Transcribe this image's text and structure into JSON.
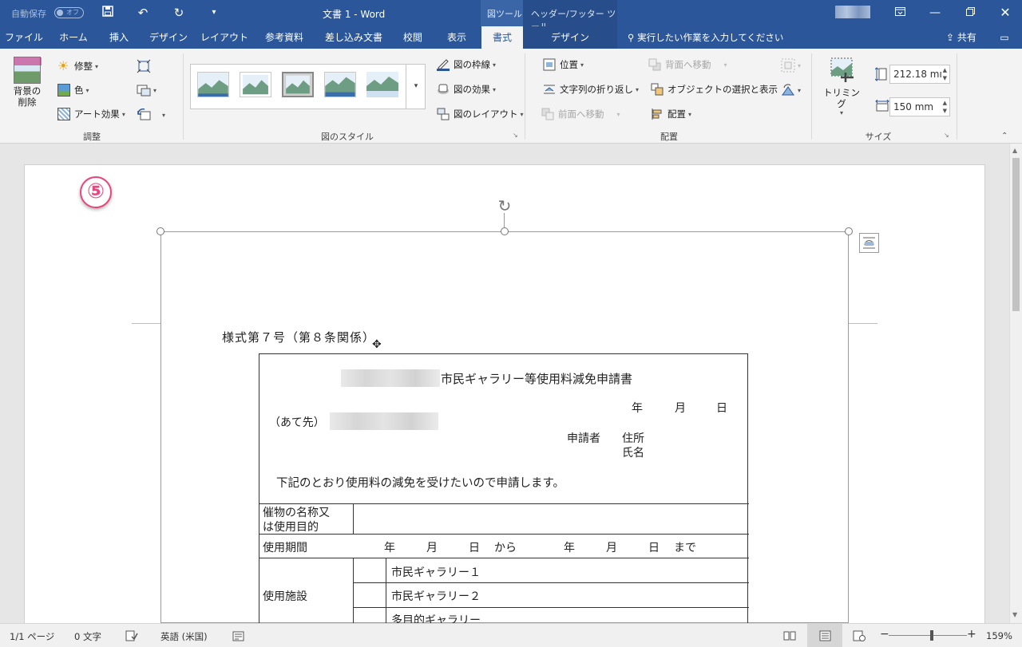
{
  "titlebar": {
    "autosave_label": "自動保存",
    "autosave_state": "オフ",
    "doc_title": "文書 1  -  Word",
    "context_picture_tools": "図ツール",
    "context_header_footer_tools": "ヘッダー/フッター ツール"
  },
  "tabs": [
    "ファイル",
    "ホーム",
    "挿入",
    "デザイン",
    "レイアウト",
    "参考資料",
    "差し込み文書",
    "校閲",
    "表示",
    "書式",
    "デザイン"
  ],
  "active_tab": "書式",
  "tell_me": "実行したい作業を入力してください",
  "share": "共有",
  "ribbon": {
    "adjust": {
      "remove_bg": "背景の削除",
      "corrections": "修整",
      "color": "色",
      "artistic": "アート効果",
      "group_label": "調整"
    },
    "styles": {
      "border": "図の枠線",
      "effects": "図の効果",
      "layout": "図のレイアウト",
      "group_label": "図のスタイル"
    },
    "arrange": {
      "position": "位置",
      "wrap": "文字列の折り返し",
      "bring_forward": "前面へ移動",
      "send_backward": "背面へ移動",
      "selection_pane": "オブジェクトの選択と表示",
      "align": "配置",
      "group_label": "配置"
    },
    "size": {
      "crop": "トリミング",
      "height": "212.18 mı",
      "width": "150 mm",
      "group_label": "サイズ"
    }
  },
  "document": {
    "step_badge": "⑤",
    "form_title": "様式第７号（第８条関係）",
    "form_heading": "市民ギャラリー等使用料減免申請書",
    "date_line": [
      "年",
      "月",
      "日"
    ],
    "addressee": "（あて先）",
    "applicant": "申請者",
    "address": "住所",
    "name": "氏名",
    "request": "下記のとおり使用料の減免を受けたいので申請します。",
    "row1_label": [
      "催物の名称又",
      "は使用目的"
    ],
    "row2_label": "使用期間",
    "period": [
      "年",
      "月",
      "日",
      "から",
      "年",
      "月",
      "日",
      "まで"
    ],
    "row3_label": "使用施設",
    "facilities": [
      "市民ギャラリー１",
      "市民ギャラリー２",
      "多目的ギャラリー"
    ]
  },
  "statusbar": {
    "page": "1/1 ページ",
    "words": "0 文字",
    "language": "英語 (米国)",
    "zoom": "159%"
  },
  "colors": {
    "word_blue": "#2b579a",
    "badge_pink": "#e8467c"
  }
}
